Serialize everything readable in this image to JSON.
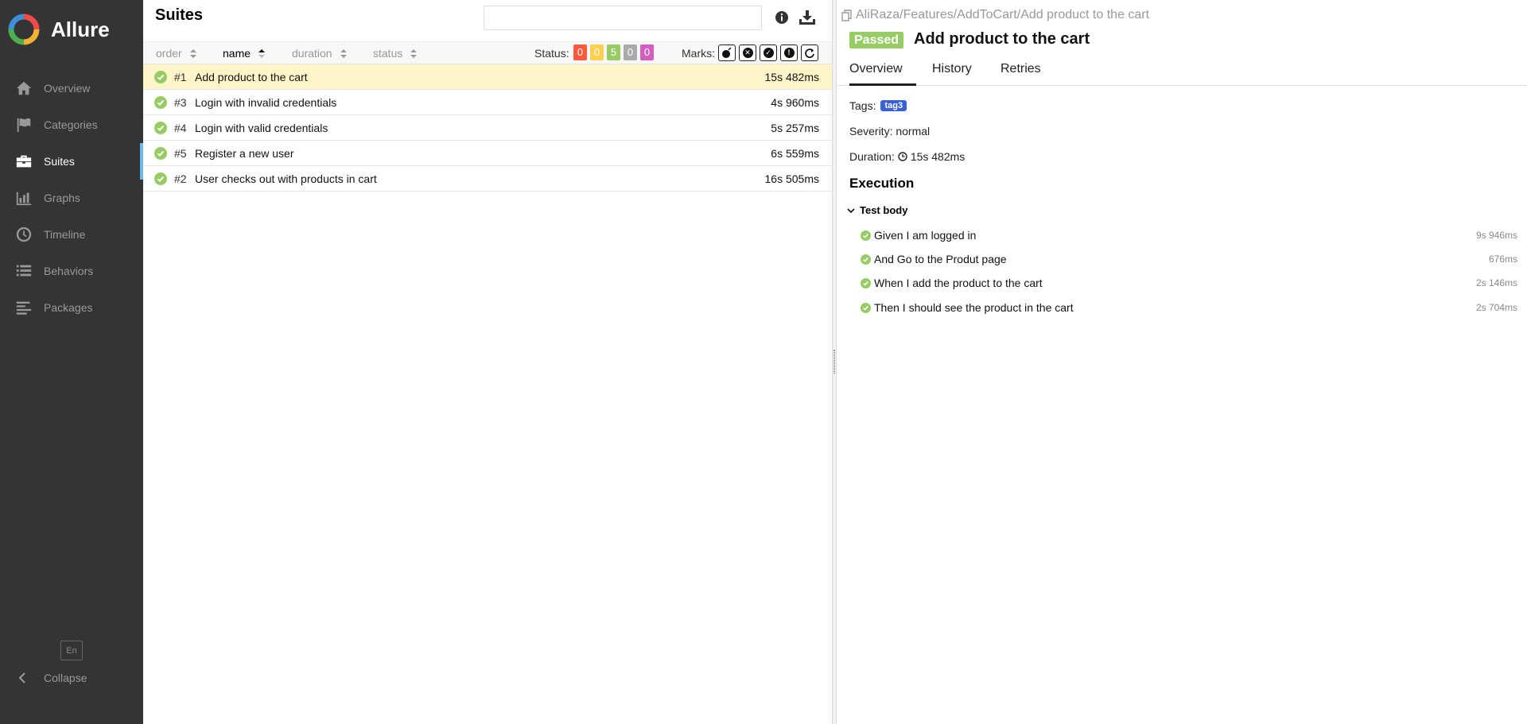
{
  "brand": {
    "name": "Allure"
  },
  "sidebar": {
    "items": [
      {
        "label": "Overview",
        "icon": "home-icon"
      },
      {
        "label": "Categories",
        "icon": "flag-icon"
      },
      {
        "label": "Suites",
        "icon": "briefcase-icon",
        "active": true
      },
      {
        "label": "Graphs",
        "icon": "bar-chart-icon"
      },
      {
        "label": "Timeline",
        "icon": "clock-icon"
      },
      {
        "label": "Behaviors",
        "icon": "list-icon"
      },
      {
        "label": "Packages",
        "icon": "align-left-icon"
      }
    ],
    "language": "En",
    "collapse_label": "Collapse"
  },
  "suites": {
    "title": "Suites",
    "search_placeholder": "",
    "sort": {
      "order": "order",
      "name": "name",
      "duration": "duration",
      "status": "status"
    },
    "status_label": "Status:",
    "status_counts": [
      {
        "value": "0",
        "color": "#fd5a3e"
      },
      {
        "value": "0",
        "color": "#ffd050"
      },
      {
        "value": "5",
        "color": "#97cc64"
      },
      {
        "value": "0",
        "color": "#aaaaaa"
      },
      {
        "value": "0",
        "color": "#d35ebe"
      }
    ],
    "marks_label": "Marks:",
    "rows": [
      {
        "num": "#1",
        "name": "Add product to the cart",
        "duration": "15s 482ms",
        "selected": true
      },
      {
        "num": "#3",
        "name": "Login with invalid credentials",
        "duration": "4s 960ms"
      },
      {
        "num": "#4",
        "name": "Login with valid credentials",
        "duration": "5s 257ms"
      },
      {
        "num": "#5",
        "name": "Register a new user",
        "duration": "6s 559ms"
      },
      {
        "num": "#2",
        "name": "User checks out with products in cart",
        "duration": "16s 505ms"
      }
    ]
  },
  "detail": {
    "breadcrumb": "AliRaza/Features/AddToCart/Add product to the cart",
    "status": "Passed",
    "title": "Add product to the cart",
    "tabs": [
      "Overview",
      "History",
      "Retries"
    ],
    "tags_label": "Tags:",
    "tag": "tag3",
    "severity": "Severity: normal",
    "duration_label": "Duration:",
    "duration": "15s 482ms",
    "execution_title": "Execution",
    "test_body_label": "Test body",
    "steps": [
      {
        "name": "Given I am logged in",
        "duration": "9s 946ms"
      },
      {
        "name": "And Go to the Produt page",
        "duration": "676ms"
      },
      {
        "name": "When I add the product to the cart",
        "duration": "2s 146ms"
      },
      {
        "name": "Then I should see the product in the cart",
        "duration": "2s 704ms"
      }
    ]
  },
  "colors": {
    "accent": "#6eb9ea",
    "passed": "#97cc64",
    "sidebar_bg": "#343434",
    "tag": "#3a60d6",
    "selected_row": "#fff5c8"
  }
}
